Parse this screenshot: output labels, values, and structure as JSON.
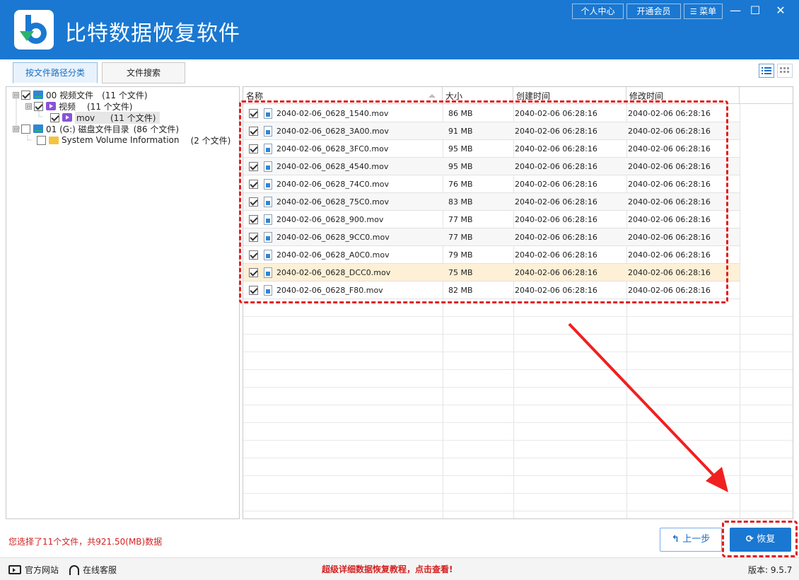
{
  "window": {
    "title": "比特数据恢复软件",
    "top_buttons": [
      "个人中心",
      "开通会员",
      "菜单"
    ],
    "controls": {
      "minimize": "—",
      "maximize": "☐",
      "close": "✕"
    }
  },
  "tabs": [
    {
      "label": "按文件路径分类",
      "active": true
    },
    {
      "label": "文件搜索",
      "active": false
    }
  ],
  "tree": {
    "items": [
      {
        "expander": "⊟",
        "checked": true,
        "icon": "drive-icon",
        "label": "00 视频文件",
        "count": "(11 个文件)"
      },
      {
        "expander": "⊟",
        "checked": true,
        "icon": "video-folder-icon",
        "label": "视频",
        "count": "(11 个文件)"
      },
      {
        "expander": "",
        "checked": true,
        "icon": "video-folder-icon",
        "label": "mov",
        "count": "(11 个文件)"
      },
      {
        "expander": "⊟",
        "checked": false,
        "icon": "drive-icon",
        "label": "01 (G:) 磁盘文件目录",
        "count": "(86 个文件)"
      },
      {
        "expander": "",
        "checked": false,
        "icon": "folder-icon",
        "label": "System Volume Information",
        "count": "(2 个文件)"
      }
    ]
  },
  "table": {
    "columns": [
      "名称",
      "大小",
      "创建时间",
      "修改时间"
    ],
    "rows": [
      {
        "name": "2040-02-06_0628_1540.mov",
        "size": "86 MB",
        "created": "2040-02-06  06:28:16",
        "modified": "2040-02-06  06:28:16"
      },
      {
        "name": "2040-02-06_0628_3A00.mov",
        "size": "91 MB",
        "created": "2040-02-06  06:28:16",
        "modified": "2040-02-06  06:28:16"
      },
      {
        "name": "2040-02-06_0628_3FC0.mov",
        "size": "95 MB",
        "created": "2040-02-06  06:28:16",
        "modified": "2040-02-06  06:28:16"
      },
      {
        "name": "2040-02-06_0628_4540.mov",
        "size": "95 MB",
        "created": "2040-02-06  06:28:16",
        "modified": "2040-02-06  06:28:16"
      },
      {
        "name": "2040-02-06_0628_74C0.mov",
        "size": "76 MB",
        "created": "2040-02-06  06:28:16",
        "modified": "2040-02-06  06:28:16"
      },
      {
        "name": "2040-02-06_0628_75C0.mov",
        "size": "83 MB",
        "created": "2040-02-06  06:28:16",
        "modified": "2040-02-06  06:28:16"
      },
      {
        "name": "2040-02-06_0628_900.mov",
        "size": "77 MB",
        "created": "2040-02-06  06:28:16",
        "modified": "2040-02-06  06:28:16"
      },
      {
        "name": "2040-02-06_0628_9CC0.mov",
        "size": "77 MB",
        "created": "2040-02-06  06:28:16",
        "modified": "2040-02-06  06:28:16"
      },
      {
        "name": "2040-02-06_0628_A0C0.mov",
        "size": "79 MB",
        "created": "2040-02-06  06:28:16",
        "modified": "2040-02-06  06:28:16"
      },
      {
        "name": "2040-02-06_0628_DCC0.mov",
        "size": "75 MB",
        "created": "2040-02-06  06:28:16",
        "modified": "2040-02-06  06:28:16"
      },
      {
        "name": "2040-02-06_0628_F80.mov",
        "size": "82 MB",
        "created": "2040-02-06  06:28:16",
        "modified": "2040-02-06  06:28:16"
      }
    ]
  },
  "status": {
    "selection": "您选择了11个文件，共921.50(MB)数据"
  },
  "actions": {
    "prev": "上一步",
    "recover": "恢复"
  },
  "footer": {
    "website": "官方网站",
    "support": "在线客服",
    "tutorial": "超级详细数据恢复教程，点击查看!",
    "version": "版本: 9.5.7"
  },
  "colors": {
    "title_bar": "#1a78d2",
    "highlight_red": "#e01f1f",
    "selected_row": "#fdf0d6"
  }
}
